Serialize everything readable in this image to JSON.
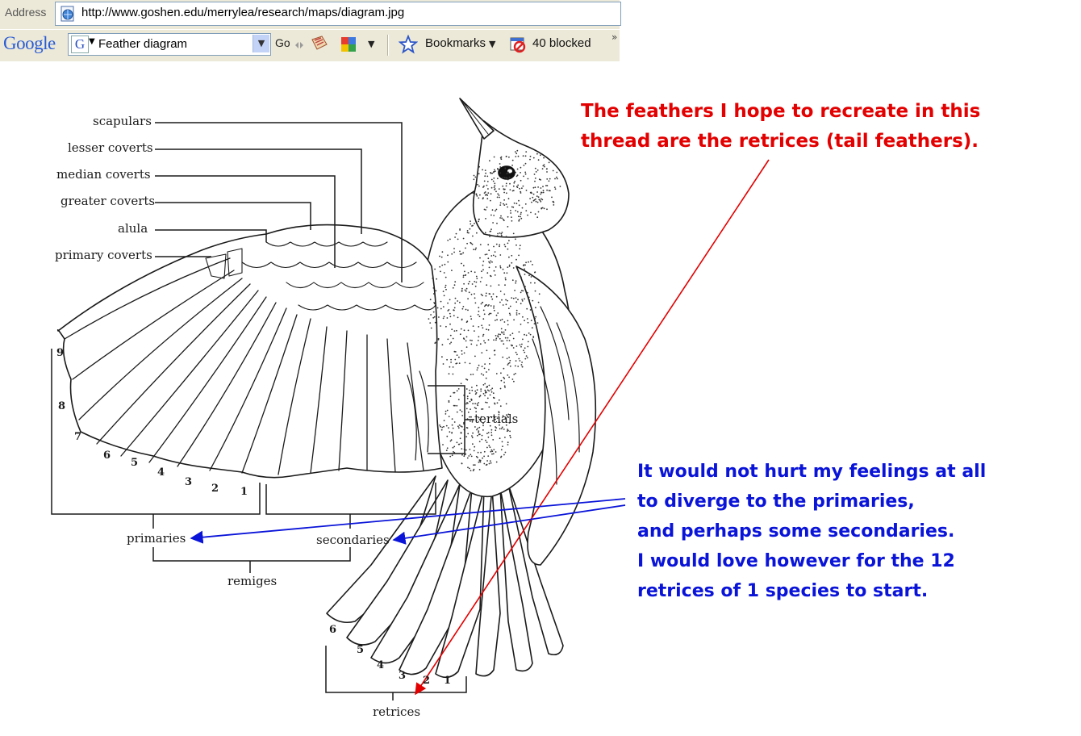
{
  "browser": {
    "address_label": "Address",
    "url": "http://www.goshen.edu/merrylea/research/maps/diagram.jpg",
    "google_logo": "Google",
    "search_value": "Feather diagram",
    "go_label": "Go",
    "bookmarks_label": "Bookmarks",
    "blocked_label": "40 blocked"
  },
  "diagram": {
    "labels": {
      "scapulars": "scapulars",
      "lesser_coverts": "lesser coverts",
      "median_coverts": "median coverts",
      "greater_coverts": "greater coverts",
      "alula": "alula",
      "primary_coverts": "primary coverts",
      "tertials": "tertials",
      "primaries": "primaries",
      "secondaries": "secondaries",
      "remiges": "remiges",
      "retrices": "retrices"
    },
    "primary_numbers": [
      "9",
      "8",
      "7",
      "6",
      "5",
      "4",
      "3",
      "2",
      "1"
    ],
    "retrix_numbers": [
      "6",
      "5",
      "4",
      "3",
      "2",
      "1"
    ]
  },
  "annotations": {
    "red_note": [
      "The feathers I hope to recreate in this",
      "thread are the retrices (tail feathers)."
    ],
    "blue_note": [
      "It would not hurt my feelings at all",
      "to diverge to the primaries,",
      "and perhaps some secondaries.",
      "I would love however for the 12",
      "retrices of 1 species to start."
    ],
    "red_color": "#e30000",
    "blue_color": "#0a14d8"
  }
}
